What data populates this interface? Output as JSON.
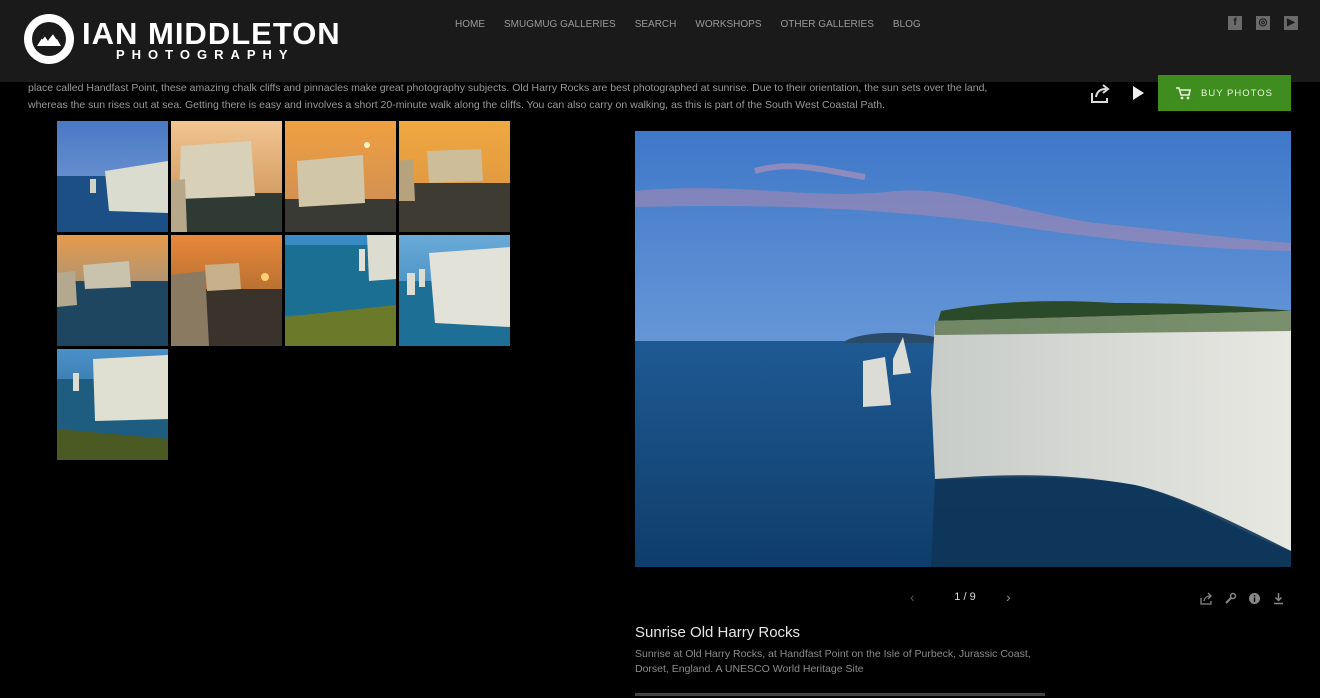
{
  "site": {
    "logo_name": "IAN MIDDLETON",
    "logo_sub": "PHOTOGRAPHY"
  },
  "nav": [
    "HOME",
    "SMUGMUG GALLERIES",
    "SEARCH",
    "WORKSHOPS",
    "OTHER GALLERIES",
    "BLOG"
  ],
  "social": [
    {
      "icon": "facebook-icon",
      "glyph": "f"
    },
    {
      "icon": "instagram-icon",
      "glyph": "◎"
    },
    {
      "icon": "youtube-icon",
      "glyph": "▶"
    }
  ],
  "description": "place called Handfast Point, these amazing chalk cliffs and pinnacles make great photography subjects. Old Harry Rocks are best photographed at sunrise. Due to their orientation, the sun sets over the land, whereas the sun rises out at sea. Getting there is easy and involves a short 20-minute walk along the cliffs. You can also carry on walking, as this is part of the South West Coastal Path.",
  "toolbar": {
    "buy_label": "BUY PHOTOS"
  },
  "pager": {
    "count": "1 / 9"
  },
  "photo": {
    "title": "Sunrise Old Harry Rocks",
    "caption": "Sunrise at Old Harry Rocks, at Handfast Point on the Isle of Purbeck, Jurassic Coast, Dorset, England. A UNESCO World Heritage Site"
  },
  "colors": {
    "header_bg": "#1a1a1a",
    "buy_button": "#3f8d1f",
    "page_bg": "#000000"
  }
}
